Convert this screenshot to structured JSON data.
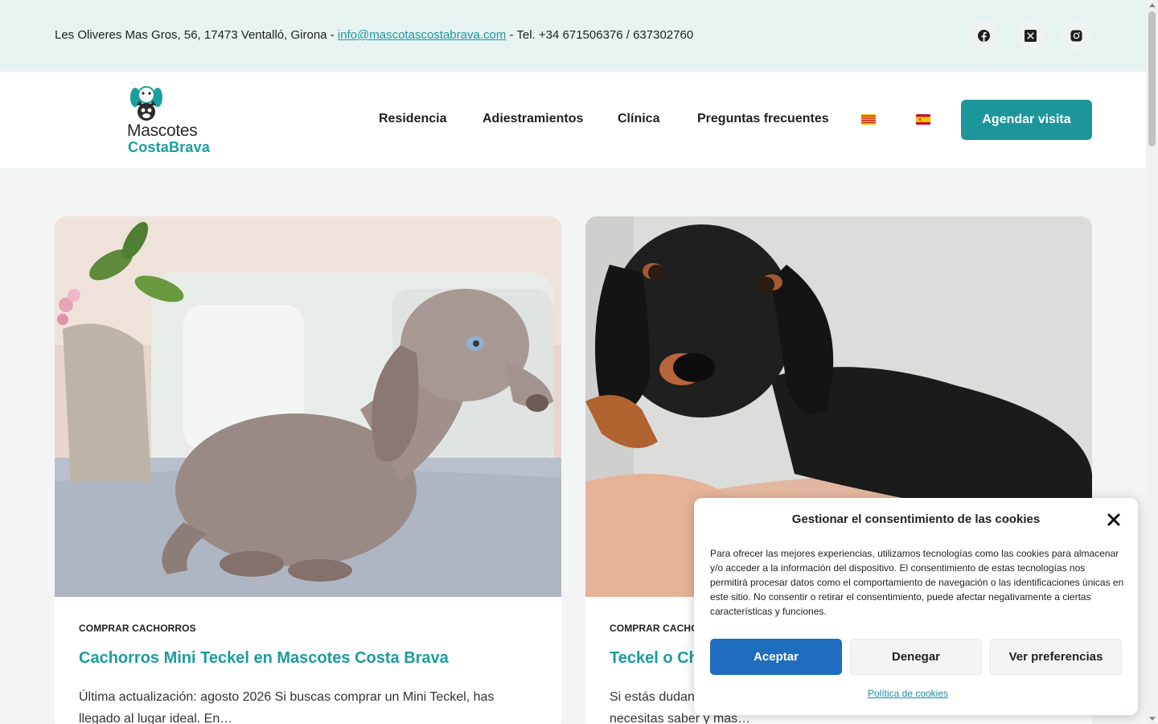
{
  "topbar": {
    "address": "Les Oliveres Mas Gros, 56, 17473 Ventalló, Girona - ",
    "email": "info@mascotascostabrava.com",
    "phone": " - Tel. +34 671506376 / 637302760",
    "social": [
      "facebook-icon",
      "x-twitter-icon",
      "instagram-icon"
    ]
  },
  "header": {
    "logo_line1": "Mascotes",
    "logo_line2": "CostaBrava",
    "nav": [
      "Residencia",
      "Adiestramientos",
      "Clínica",
      "Preguntas frecuentes"
    ],
    "languages": [
      "catalan-flag-icon",
      "spanish-flag-icon"
    ],
    "cta": "Agendar visita"
  },
  "posts": [
    {
      "category": "COMPRAR CACHORROS",
      "title": "Cachorros Mini Teckel en Mascotes Costa Brava",
      "excerpt": "Última actualización: agosto 2026 Si buscas comprar un Mini Teckel, has llegado al lugar ideal. En…"
    },
    {
      "category": "COMPRAR CACHORROS",
      "title": "Teckel o Chihuahua",
      "excerpt": "Si estás dudando entre un Teckel o un Chihuahua, te explicamos todo lo que necesitas saber y más…"
    }
  ],
  "cookie": {
    "title": "Gestionar el consentimiento de las cookies",
    "text": "Para ofrecer las mejores experiencias, utilizamos tecnologías como las cookies para almacenar y/o acceder a la información del dispositivo. El consentimiento de estas tecnologías nos permitirá procesar datos como el comportamiento de navegación o las identificaciones únicas en este sitio. No consentir o retirar el consentimiento, puede afectar negativamente a ciertas características y funciones.",
    "accept": "Aceptar",
    "deny": "Denegar",
    "prefs": "Ver preferencias",
    "policy": "Política de cookies"
  },
  "colors": {
    "brand_teal": "#1c969b",
    "topbar_bg": "#e7f3f1",
    "accept_blue": "#1e6dbe"
  }
}
